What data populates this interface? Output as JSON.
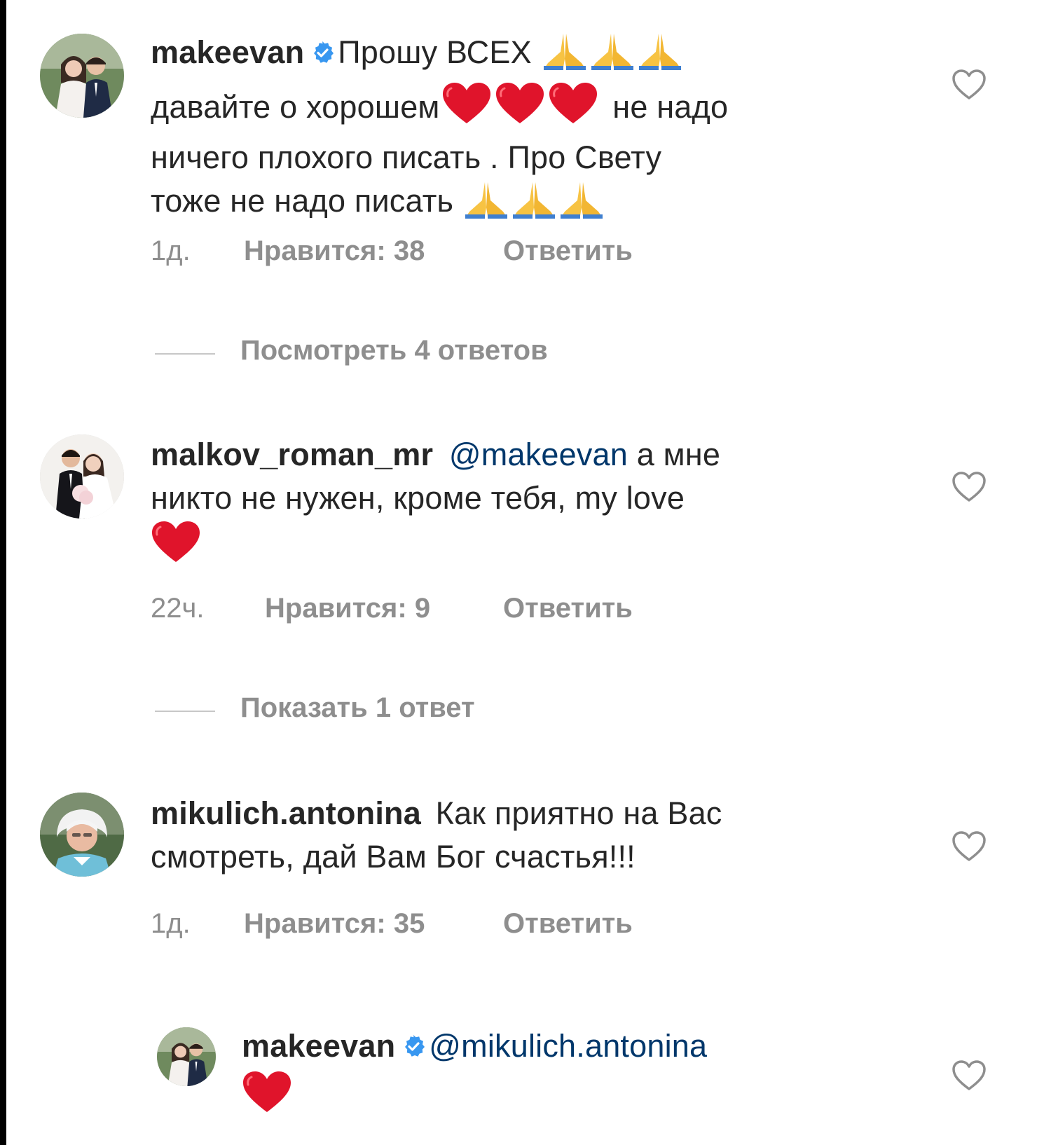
{
  "comments": [
    {
      "username": "makeevan",
      "verified": true,
      "lines": [
        {
          "text": "Прошу ВСЕХ",
          "emoji": [
            "pray",
            "pray",
            "pray"
          ]
        },
        {
          "text": "давайте о хорошем",
          "emoji": [
            "heart",
            "heart",
            "heart"
          ],
          "after": "не надо"
        },
        {
          "text": "ничего плохого писать . Про Свету"
        },
        {
          "text": "тоже не надо писать",
          "emoji": [
            "pray",
            "pray",
            "pray"
          ]
        }
      ],
      "time": "1д.",
      "likes": "Нравится: 38",
      "reply": "Ответить",
      "replies_toggle": "Посмотреть 4 ответов"
    },
    {
      "username": "malkov_roman_mr",
      "mention": "@makeevan",
      "line1_after_mention": "а мне",
      "line2": "никто не нужен, кроме тебя, my love",
      "time": "22ч.",
      "likes": "Нравится: 9",
      "reply": "Ответить",
      "replies_toggle": "Показать 1 ответ"
    },
    {
      "username": "mikulich.antonina",
      "line1": "Как приятно на Вас",
      "line2": "смотреть, дай Вам Бог счастья!!!",
      "time": "1д.",
      "likes": "Нравится: 35",
      "reply": "Ответить"
    },
    {
      "username": "makeevan",
      "verified": true,
      "mention": "@mikulich.antonina"
    }
  ],
  "icons": {
    "verified": "verified-badge-icon",
    "like": "heart-outline-icon",
    "pray": "folded-hands-emoji",
    "heart": "red-heart-emoji"
  },
  "colors": {
    "text": "#262626",
    "secondary": "#8e8e8e",
    "mention": "#00376b",
    "verified": "#3897f0",
    "heart_emoji": "#e0142b"
  }
}
